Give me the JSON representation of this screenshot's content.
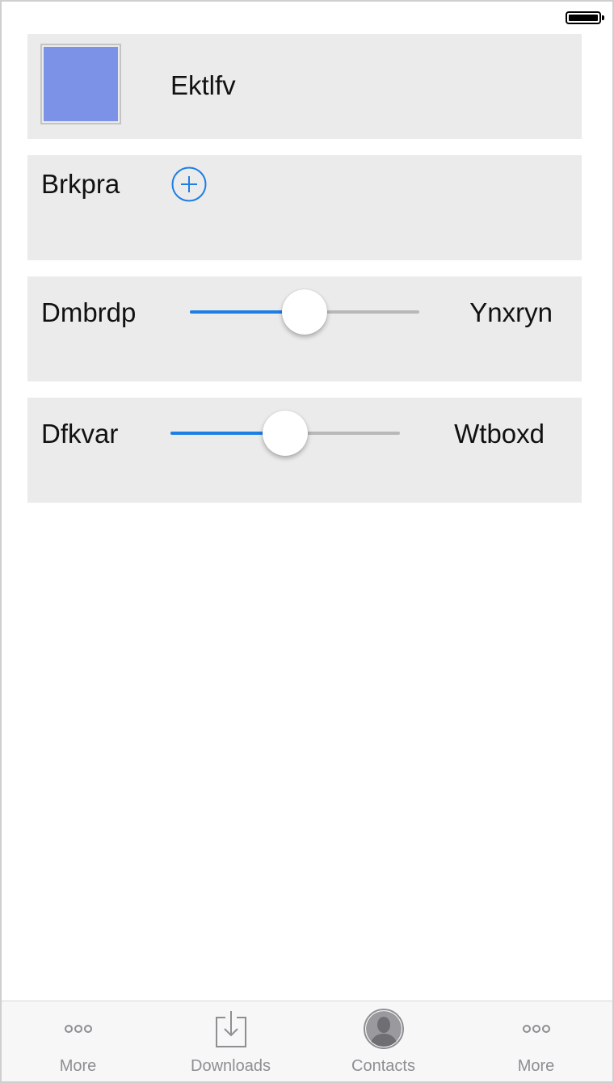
{
  "colors": {
    "swatch": "#7b92e6",
    "accent": "#1d7ee3",
    "tab_inactive": "#8e8e93"
  },
  "cells": {
    "swatch_row": {
      "label": "Ektlfv"
    },
    "add_row": {
      "label": "Brkpra",
      "icon": "plus-circle-icon"
    },
    "slider_one": {
      "label": "Dmbrdp",
      "value_label": "Ynxryn",
      "value": 0.5
    },
    "slider_two": {
      "label": "Dfkvar",
      "value_label": "Wtboxd",
      "value": 0.5
    }
  },
  "tab_bar": {
    "items": [
      {
        "label": "More",
        "icon": "more-icon"
      },
      {
        "label": "Downloads",
        "icon": "download-icon"
      },
      {
        "label": "Contacts",
        "icon": "contact-icon"
      },
      {
        "label": "More",
        "icon": "more-icon"
      }
    ]
  }
}
